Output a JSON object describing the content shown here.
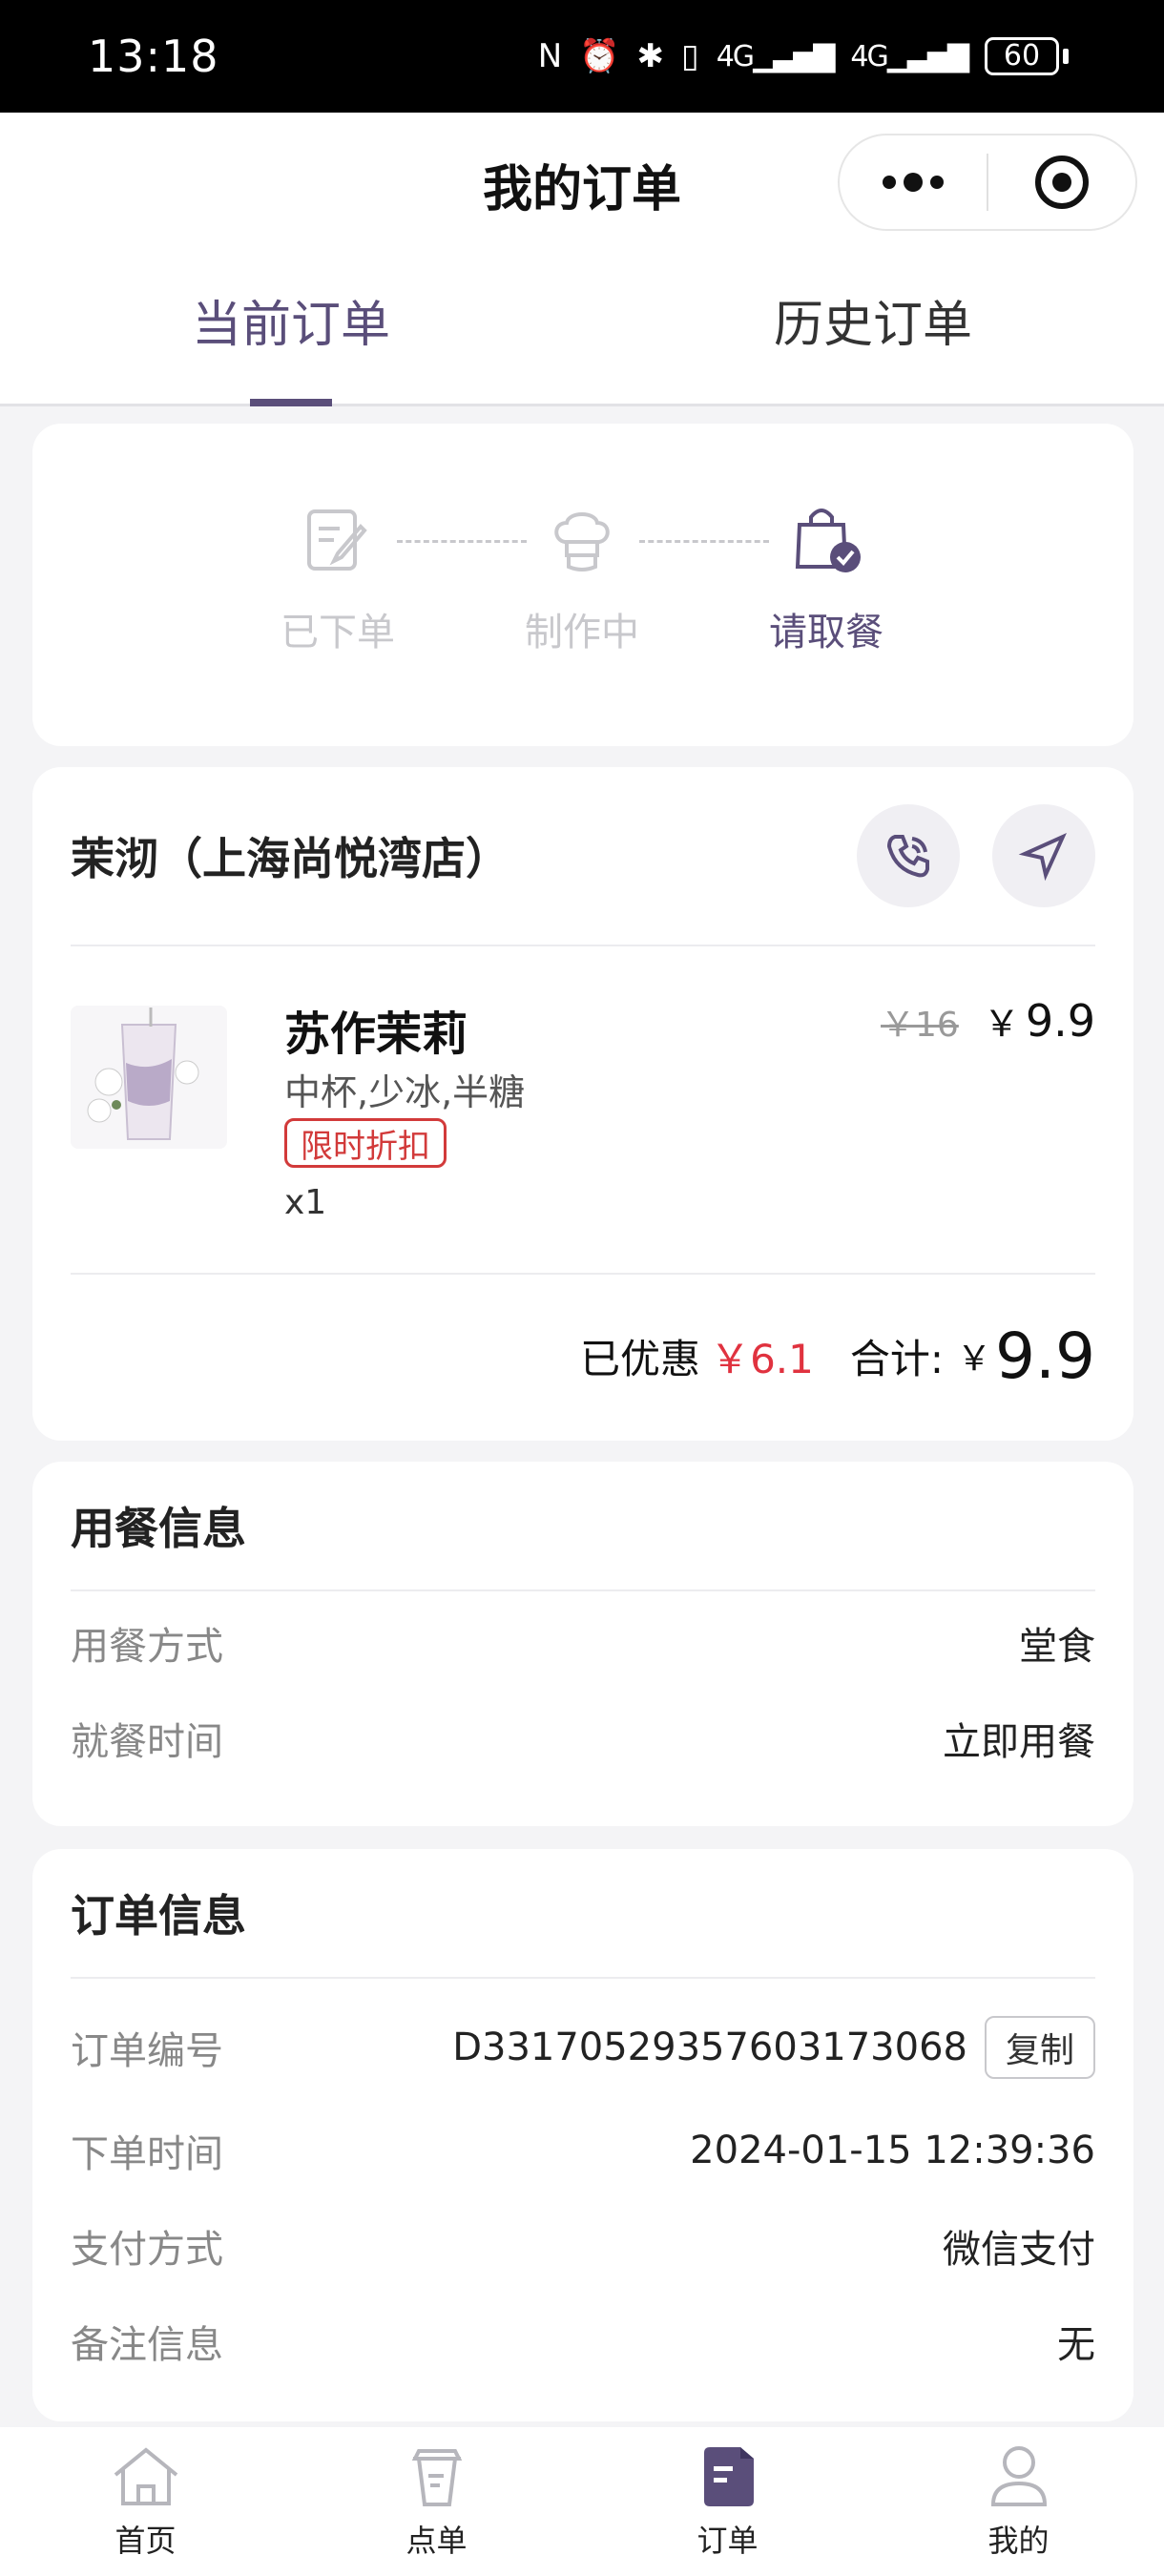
{
  "status_bar": {
    "time": "13:18",
    "network1": "4G",
    "network2": "4G",
    "battery": "60"
  },
  "header": {
    "title": "我的订单"
  },
  "tabs": [
    {
      "label": "当前订单",
      "active": true
    },
    {
      "label": "历史订单",
      "active": false
    }
  ],
  "progress": {
    "steps": [
      {
        "label": "已下单",
        "icon": "edit-note-icon",
        "active": false
      },
      {
        "label": "制作中",
        "icon": "chef-hat-icon",
        "active": false
      },
      {
        "label": "请取餐",
        "icon": "shopping-bag-check-icon",
        "active": true
      }
    ]
  },
  "store": {
    "name": "茉沏（上海尚悦湾店）"
  },
  "item": {
    "name": "苏作茉莉",
    "spec": "中杯,少冰,半糖",
    "badge": "限时折扣",
    "qty": "x1",
    "orig_price": "￥16",
    "yen": "￥",
    "price": "9.9"
  },
  "totals": {
    "discount_label": "已优惠",
    "discount_value": "￥6.1",
    "total_label": "合计:",
    "total_yen": "￥",
    "total_value": "9.9"
  },
  "dining_info": {
    "title": "用餐信息",
    "rows": [
      {
        "label": "用餐方式",
        "value": "堂食"
      },
      {
        "label": "就餐时间",
        "value": "立即用餐"
      }
    ]
  },
  "order_info": {
    "title": "订单信息",
    "order_no_label": "订单编号",
    "order_no": "D3317052935760317306​8",
    "copy_label": "复制",
    "rows": [
      {
        "label": "下单时间",
        "value": "2024-01-15 12:39:36"
      },
      {
        "label": "支付方式",
        "value": "微信支付"
      },
      {
        "label": "备注信息",
        "value": "无"
      }
    ]
  },
  "bottom_nav": [
    {
      "label": "首页",
      "icon": "home-icon",
      "active": false
    },
    {
      "label": "点单",
      "icon": "drink-cup-icon",
      "active": false
    },
    {
      "label": "订单",
      "icon": "order-list-icon",
      "active": true
    },
    {
      "label": "我的",
      "icon": "profile-icon",
      "active": false
    }
  ],
  "colors": {
    "accent": "#5a4e7a",
    "discount_red": "#e0323f",
    "badge_red": "#d23a3a"
  }
}
